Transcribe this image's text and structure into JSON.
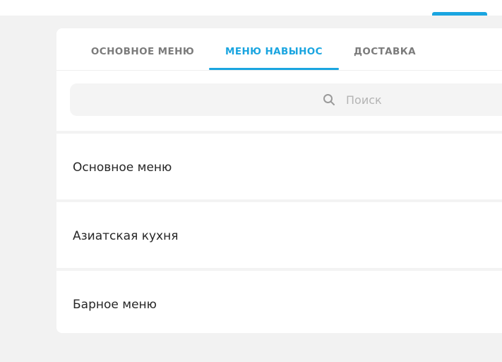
{
  "tabs": [
    {
      "label": "ОСНОВНОЕ МЕНЮ",
      "active": false
    },
    {
      "label": "МЕНЮ НАВЫНОС",
      "active": true
    },
    {
      "label": "ДОСТАВКА",
      "active": false
    }
  ],
  "search": {
    "placeholder": "Поиск",
    "icon": "search-icon"
  },
  "menus": [
    {
      "label": "Основное меню"
    },
    {
      "label": "Азиатская кухня"
    },
    {
      "label": "Барное меню"
    }
  ],
  "colors": {
    "accent": "#1aa5e0",
    "background": "#f2f2f2"
  }
}
